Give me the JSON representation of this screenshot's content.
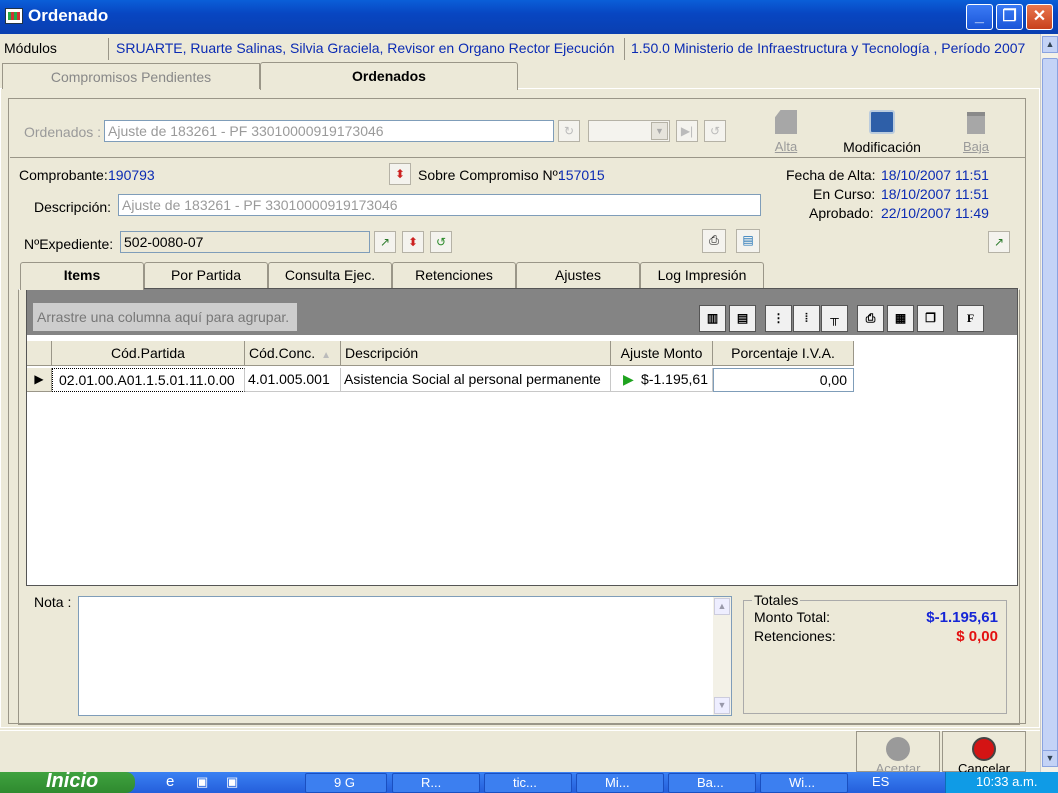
{
  "window": {
    "title": "Ordenado"
  },
  "modules": {
    "label": "Módulos",
    "user": "SRUARTE, Ruarte Salinas, Silvia Graciela, Revisor en Organo Rector Ejecución",
    "context": "1.50.0 Ministerio de Infraestructura y Tecnología , Período 2007"
  },
  "main_tabs": [
    {
      "label": "Compromisos Pendientes",
      "active": false
    },
    {
      "label": "Ordenados",
      "active": true
    }
  ],
  "toolbar": {
    "ordenados_label": "Ordenados :",
    "ordenados_value": "Ajuste de  183261 - PF 33010000919173046",
    "alta": "Alta",
    "modificacion": "Modificación",
    "baja": "Baja"
  },
  "header": {
    "comprobante_label": "Comprobante:",
    "comprobante_value": "190793",
    "sobre_label": "Sobre Compromiso Nº:",
    "sobre_value": "157015",
    "descripcion_label": "Descripción:",
    "descripcion_value": "Ajuste de  183261 - PF 33010000919173046",
    "expediente_label": "NºExpediente:",
    "expediente_value": "502-0080-07",
    "fecha_alta_label": "Fecha de Alta:",
    "fecha_alta_value": "18/10/2007 11:51",
    "en_curso_label": "En Curso:",
    "en_curso_value": "18/10/2007 11:51",
    "aprobado_label": "Aprobado:",
    "aprobado_value": "22/10/2007 11:49"
  },
  "sub_tabs": [
    {
      "label": "Items",
      "active": true
    },
    {
      "label": "Por Partida",
      "active": false
    },
    {
      "label": "Consulta Ejec.",
      "active": false
    },
    {
      "label": "Retenciones",
      "active": false
    },
    {
      "label": "Ajustes",
      "active": false
    },
    {
      "label": "Log Impresión",
      "active": false
    }
  ],
  "grid": {
    "group_hint": "Arrastre una columna aquí para agrupar.",
    "columns": [
      "Cód.Partida",
      "Cód.Conc.",
      "Descripción",
      "Ajuste Monto",
      "Porcentaje  I.V.A."
    ],
    "rows": [
      [
        "02.01.00.A01.1.5.01.11.0.00",
        "4.01.005.001",
        "Asistencia Social al personal permanente",
        "$-1.195,61",
        "0,00"
      ]
    ]
  },
  "nota": {
    "label": "Nota :",
    "value": ""
  },
  "totales": {
    "legend": "Totales",
    "monto_label": "Monto Total:",
    "monto_value": "$-1.195,61",
    "retenciones_label": "Retenciones:",
    "retenciones_value": "$ 0,00"
  },
  "actions": {
    "aceptar": "Aceptar",
    "cancelar": "Cancelar"
  },
  "taskbar": {
    "start": "Inicio",
    "tasks": [
      "9 G",
      "R...",
      "tic...",
      "Mi...",
      "Ba...",
      "Wi..."
    ],
    "lang": "ES",
    "clock": "10:33 a.m."
  },
  "colors": {
    "link_blue": "#0b2bb3",
    "total_blue": "#1626d6",
    "retention_red": "#e31010"
  }
}
